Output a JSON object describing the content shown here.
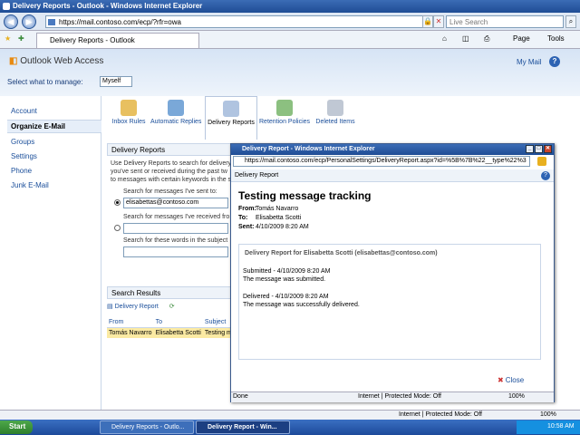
{
  "window_title": "Delivery Reports - Outlook - Windows Internet Explorer",
  "address": "https://mail.contoso.com/ecp/?rfr=owa",
  "search_placeholder": "Live Search",
  "tab_title": "Delivery Reports - Outlook",
  "toolbar": {
    "page": "Page",
    "tools": "Tools"
  },
  "owa": {
    "logo": "Outlook Web Access",
    "my_mail": "My Mail",
    "manage_label": "Select what to manage:",
    "manage_value": "Myself"
  },
  "sidebar": [
    "Account",
    "Organize E-Mail",
    "Groups",
    "Settings",
    "Phone",
    "Junk E-Mail"
  ],
  "tabs": [
    "Inbox Rules",
    "Automatic Replies",
    "Delivery Reports",
    "Retention Policies",
    "Deleted Items"
  ],
  "panel": {
    "header": "Delivery Reports",
    "desc1": "Use Delivery Reports to search for delivery",
    "desc2": "you've sent or received during the past tw",
    "desc3": "to messages with certain keywords in the s",
    "sent_to_label": "Search for messages I've sent to:",
    "sent_to_value": "elisabettas@contoso.com",
    "received_label": "Search for messages I've received fro",
    "words_label": "Search for these words in the subject"
  },
  "results": {
    "header": "Search Results",
    "toolbar_label": "Delivery Report",
    "columns": [
      "From",
      "To",
      "Subject"
    ],
    "row": [
      "Tomás Navarro",
      "Elisabetta Scotti",
      "Testing m"
    ]
  },
  "popup": {
    "title": "Delivery Report - Windows Internet Explorer",
    "address": "https://mail.contoso.com/ecp/PersonalSettings/DeliveryReport.aspx?id=%5B%7B%22__type%22%3",
    "header": "Delivery Report",
    "subject": "Testing message tracking",
    "from_label": "From:",
    "from": "Tomás Navarro",
    "to_label": "To:",
    "to": "Elisabetta Scotti",
    "sent_label": "Sent:",
    "sent": "4/10/2009 8:20 AM",
    "report_title": "Delivery Report for Elisabetta Scotti (elisabettas@contoso.com)",
    "submitted": "Submitted - 4/10/2009 8:20 AM",
    "submitted_msg": "The message was submitted.",
    "delivered": "Delivered - 4/10/2009 8:20 AM",
    "delivered_msg": "The message was successfully delivered.",
    "close": "Close",
    "status_done": "Done",
    "status_zone": "Internet | Protected Mode: Off",
    "zoom": "100%"
  },
  "status": {
    "zone": "Internet | Protected Mode: Off",
    "zoom": "100%"
  },
  "taskbar": {
    "start": "Start",
    "task1": "Delivery Reports - Outlo...",
    "task2": "Delivery Report - Win...",
    "clock": "10:58 AM"
  }
}
